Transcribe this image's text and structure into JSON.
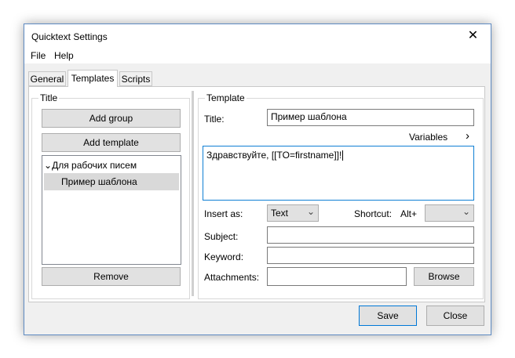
{
  "window": {
    "title": "Quicktext Settings",
    "close_glyph": "✕"
  },
  "menu": {
    "file": "File",
    "help": "Help"
  },
  "tabs": [
    {
      "label": "General"
    },
    {
      "label": "Templates"
    },
    {
      "label": "Scripts"
    }
  ],
  "title_panel": {
    "legend": "Title",
    "add_group": "Add group",
    "add_template": "Add template",
    "tree": {
      "group_label": "Для рабочих писем",
      "item_label": "Пример шаблона",
      "expand_glyph": "⌄"
    },
    "remove": "Remove"
  },
  "template_panel": {
    "legend": "Template",
    "title_label": "Title:",
    "title_value": "Пример шаблона",
    "variables_label": "Variables",
    "variables_arrow": "›",
    "body_text": "Здравствуйте, [[TO=firstname]]!",
    "insert_as_label": "Insert as:",
    "insert_as_value": "Text",
    "shortcut_label": "Shortcut:",
    "shortcut_prefix": "Alt+",
    "shortcut_value": "",
    "subject_label": "Subject:",
    "keyword_label": "Keyword:",
    "attachments_label": "Attachments:",
    "browse": "Browse"
  },
  "footer": {
    "save": "Save",
    "close": "Close"
  }
}
